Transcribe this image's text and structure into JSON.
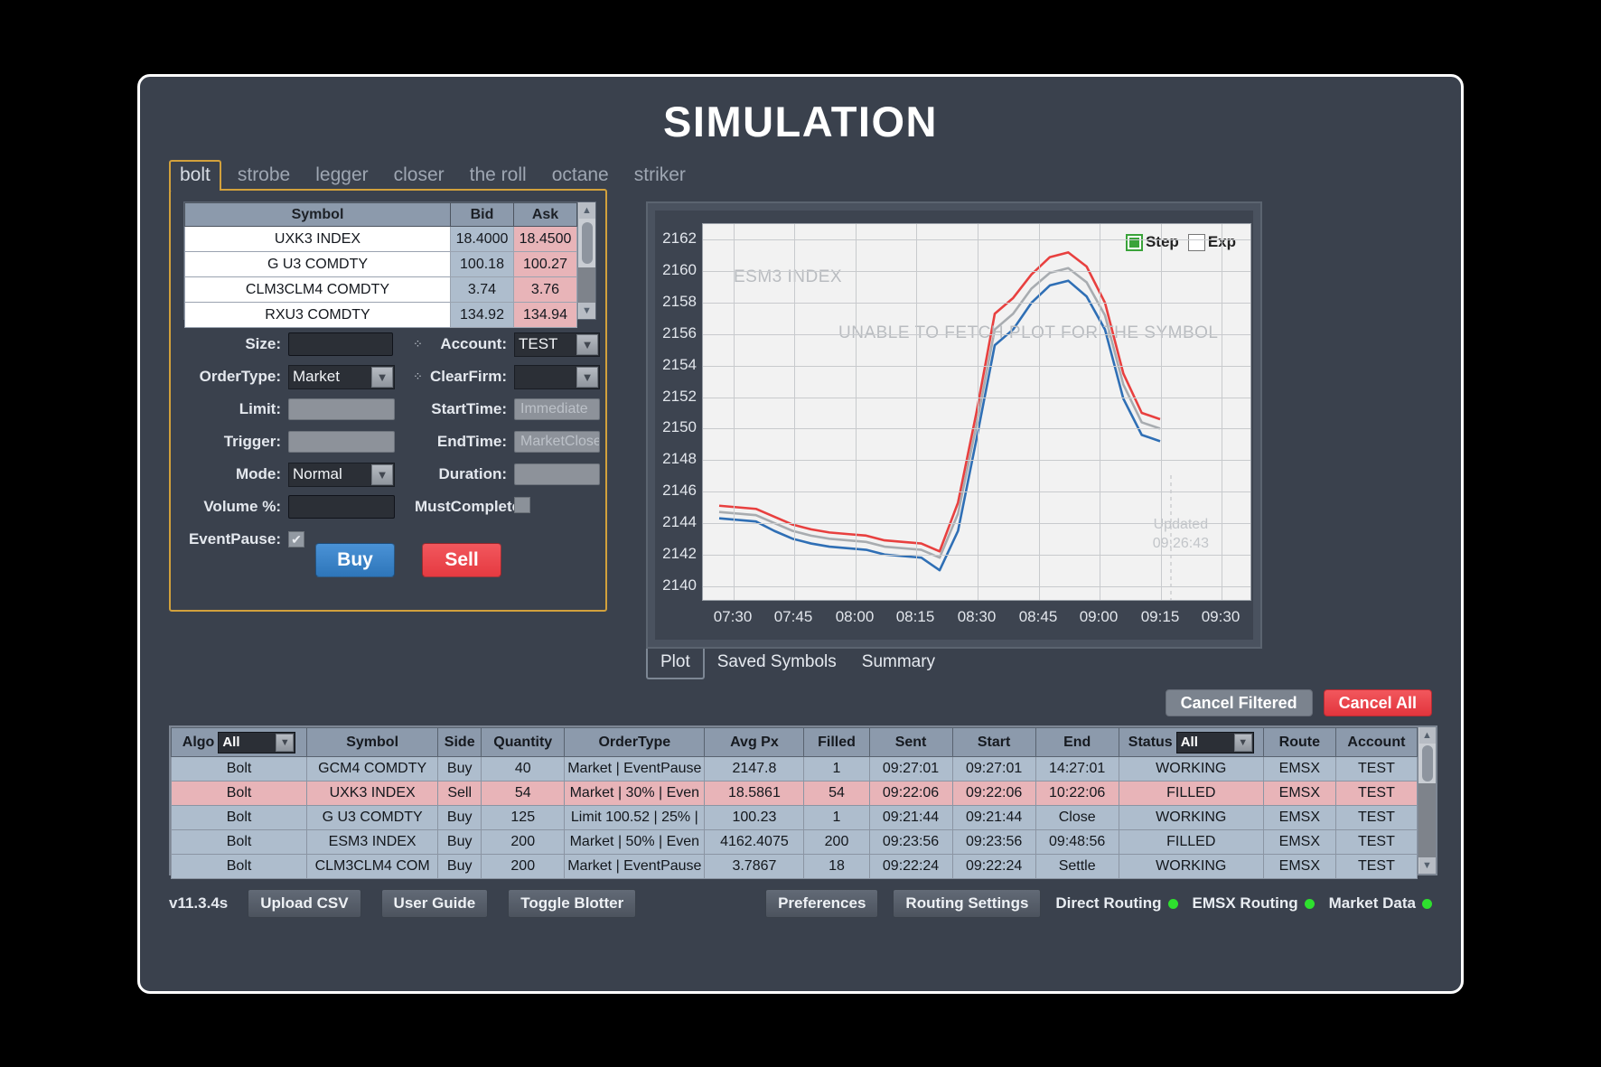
{
  "window": {
    "title": "SIMULATION"
  },
  "tabs": [
    {
      "label": "bolt",
      "active": true
    },
    {
      "label": "strobe",
      "active": false
    },
    {
      "label": "legger",
      "active": false
    },
    {
      "label": "closer",
      "active": false
    },
    {
      "label": "the roll",
      "active": false
    },
    {
      "label": "octane",
      "active": false
    },
    {
      "label": "striker",
      "active": false
    }
  ],
  "symbol_table": {
    "headers": [
      "Symbol",
      "Bid",
      "Ask"
    ],
    "rows": [
      {
        "symbol": "UXK3 INDEX",
        "bid": "18.4000",
        "ask": "18.4500"
      },
      {
        "symbol": "G U3 COMDTY",
        "bid": "100.18",
        "ask": "100.27"
      },
      {
        "symbol": "CLM3CLM4 COMDTY",
        "bid": "3.74",
        "ask": "3.76"
      },
      {
        "symbol": "RXU3 COMDTY",
        "bid": "134.92",
        "ask": "134.94"
      }
    ]
  },
  "order_form": {
    "left": {
      "size_label": "Size:",
      "size_value": "",
      "ordertype_label": "OrderType:",
      "ordertype_value": "Market",
      "limit_label": "Limit:",
      "limit_value": "",
      "trigger_label": "Trigger:",
      "trigger_value": "",
      "mode_label": "Mode:",
      "mode_value": "Normal",
      "volume_label": "Volume %:",
      "volume_value": "",
      "eventpause_label": "EventPause:",
      "eventpause_checked": "✔"
    },
    "right": {
      "account_label": "Account:",
      "account_value": "TEST",
      "clearfirm_label": "ClearFirm:",
      "clearfirm_value": "",
      "starttime_label": "StartTime:",
      "starttime_placeholder": "Immediate",
      "endtime_label": "EndTime:",
      "endtime_placeholder": "MarketClose",
      "duration_label": "Duration:",
      "duration_value": "",
      "mustcomplete_label": "MustComplete:"
    },
    "buy_label": "Buy",
    "sell_label": "Sell"
  },
  "chart_tabs": [
    {
      "label": "Plot",
      "active": true
    },
    {
      "label": "Saved Symbols",
      "active": false
    },
    {
      "label": "Summary",
      "active": false
    }
  ],
  "chart_data": {
    "type": "line",
    "title": "",
    "symbol_watermark": "ESM3 INDEX",
    "error_watermark": "UNABLE TO FETCH PLOT FOR THE SYMBOL",
    "updated_label": "Updated",
    "updated_time": "09:26:43",
    "xlabel": "",
    "ylabel": "",
    "grid": true,
    "legend_position": "top-right",
    "legend": [
      {
        "label": "Step",
        "checked": true,
        "color": "#3aa33a"
      },
      {
        "label": "Exp",
        "checked": false,
        "color": "#ffffff"
      }
    ],
    "ylim": [
      2139,
      2163
    ],
    "yticks": [
      2140,
      2142,
      2144,
      2146,
      2148,
      2150,
      2152,
      2154,
      2156,
      2158,
      2160,
      2162
    ],
    "xticks": [
      "07:30",
      "07:45",
      "08:00",
      "08:15",
      "08:30",
      "08:45",
      "09:00",
      "09:15",
      "09:30"
    ],
    "x": [
      "07:30",
      "07:35",
      "07:40",
      "07:45",
      "07:50",
      "07:55",
      "08:00",
      "08:05",
      "08:10",
      "08:15",
      "08:20",
      "08:25",
      "08:30",
      "08:33",
      "08:36",
      "08:40",
      "08:45",
      "08:50",
      "08:55",
      "09:00",
      "09:05",
      "09:10",
      "09:15",
      "09:20",
      "09:25"
    ],
    "series": [
      {
        "name": "upper",
        "color": "#e8403f",
        "values": [
          2145.1,
          2145.0,
          2144.9,
          2144.4,
          2143.9,
          2143.6,
          2143.4,
          2143.3,
          2143.2,
          2142.9,
          2142.8,
          2142.7,
          2142.2,
          2145.3,
          2151.0,
          2157.3,
          2158.3,
          2159.8,
          2160.9,
          2161.2,
          2160.3,
          2158.0,
          2153.5,
          2151.0,
          2150.6
        ]
      },
      {
        "name": "mid",
        "color": "#a8acb0",
        "values": [
          2144.7,
          2144.6,
          2144.5,
          2144.0,
          2143.5,
          2143.2,
          2143.0,
          2142.9,
          2142.8,
          2142.5,
          2142.4,
          2142.3,
          2141.8,
          2144.6,
          2150.2,
          2156.3,
          2157.3,
          2158.9,
          2159.9,
          2160.2,
          2159.3,
          2157.2,
          2152.8,
          2150.4,
          2150.0
        ]
      },
      {
        "name": "lower",
        "color": "#2f6fb5",
        "values": [
          2144.3,
          2144.2,
          2144.1,
          2143.5,
          2143.0,
          2142.7,
          2142.5,
          2142.4,
          2142.3,
          2142.0,
          2141.9,
          2141.8,
          2141.0,
          2143.5,
          2149.3,
          2155.3,
          2156.3,
          2158.0,
          2159.1,
          2159.4,
          2158.4,
          2156.3,
          2151.9,
          2149.6,
          2149.2
        ]
      }
    ]
  },
  "cancel_buttons": {
    "filtered_label": "Cancel Filtered",
    "all_label": "Cancel All"
  },
  "blotter": {
    "headers": [
      {
        "label": "Algo",
        "filter": "All"
      },
      {
        "label": "Symbol"
      },
      {
        "label": "Side"
      },
      {
        "label": "Quantity"
      },
      {
        "label": "OrderType"
      },
      {
        "label": "Avg Px"
      },
      {
        "label": "Filled"
      },
      {
        "label": "Sent"
      },
      {
        "label": "Start"
      },
      {
        "label": "End"
      },
      {
        "label": "Status",
        "filter": "All"
      },
      {
        "label": "Route"
      },
      {
        "label": "Account"
      }
    ],
    "rows": [
      {
        "algo": "Bolt",
        "symbol": "GCM4 COMDTY",
        "side": "Buy",
        "quantity": "40",
        "ordertype": "Market | EventPause",
        "avg_px": "2147.8",
        "filled": "1",
        "sent": "09:27:01",
        "start": "09:27:01",
        "end": "14:27:01",
        "status": "WORKING",
        "route": "EMSX",
        "account": "TEST",
        "highlight": false
      },
      {
        "algo": "Bolt",
        "symbol": "UXK3 INDEX",
        "side": "Sell",
        "quantity": "54",
        "ordertype": "Market | 30% | Even",
        "avg_px": "18.5861",
        "filled": "54",
        "sent": "09:22:06",
        "start": "09:22:06",
        "end": "10:22:06",
        "status": "FILLED",
        "route": "EMSX",
        "account": "TEST",
        "highlight": true
      },
      {
        "algo": "Bolt",
        "symbol": "G U3 COMDTY",
        "side": "Buy",
        "quantity": "125",
        "ordertype": "Limit 100.52 | 25% |",
        "avg_px": "100.23",
        "filled": "1",
        "sent": "09:21:44",
        "start": "09:21:44",
        "end": "Close",
        "status": "WORKING",
        "route": "EMSX",
        "account": "TEST",
        "highlight": false
      },
      {
        "algo": "Bolt",
        "symbol": "ESM3 INDEX",
        "side": "Buy",
        "quantity": "200",
        "ordertype": "Market | 50% | Even",
        "avg_px": "4162.4075",
        "filled": "200",
        "sent": "09:23:56",
        "start": "09:23:56",
        "end": "09:48:56",
        "status": "FILLED",
        "route": "EMSX",
        "account": "TEST",
        "highlight": false
      },
      {
        "algo": "Bolt",
        "symbol": "CLM3CLM4 COM",
        "side": "Buy",
        "quantity": "200",
        "ordertype": "Market | EventPause",
        "avg_px": "3.7867",
        "filled": "18",
        "sent": "09:22:24",
        "start": "09:22:24",
        "end": "Settle",
        "status": "WORKING",
        "route": "EMSX",
        "account": "TEST",
        "highlight": false
      }
    ]
  },
  "footer": {
    "version": "v11.3.4s",
    "buttons": [
      "Upload CSV",
      "User Guide",
      "Toggle Blotter"
    ],
    "right_buttons": [
      "Preferences",
      "Routing Settings"
    ],
    "status": [
      {
        "label": "Direct Routing",
        "color": "#2ee02e"
      },
      {
        "label": "EMSX Routing",
        "color": "#2ee02e"
      },
      {
        "label": "Market Data",
        "color": "#2ee02e"
      }
    ]
  }
}
